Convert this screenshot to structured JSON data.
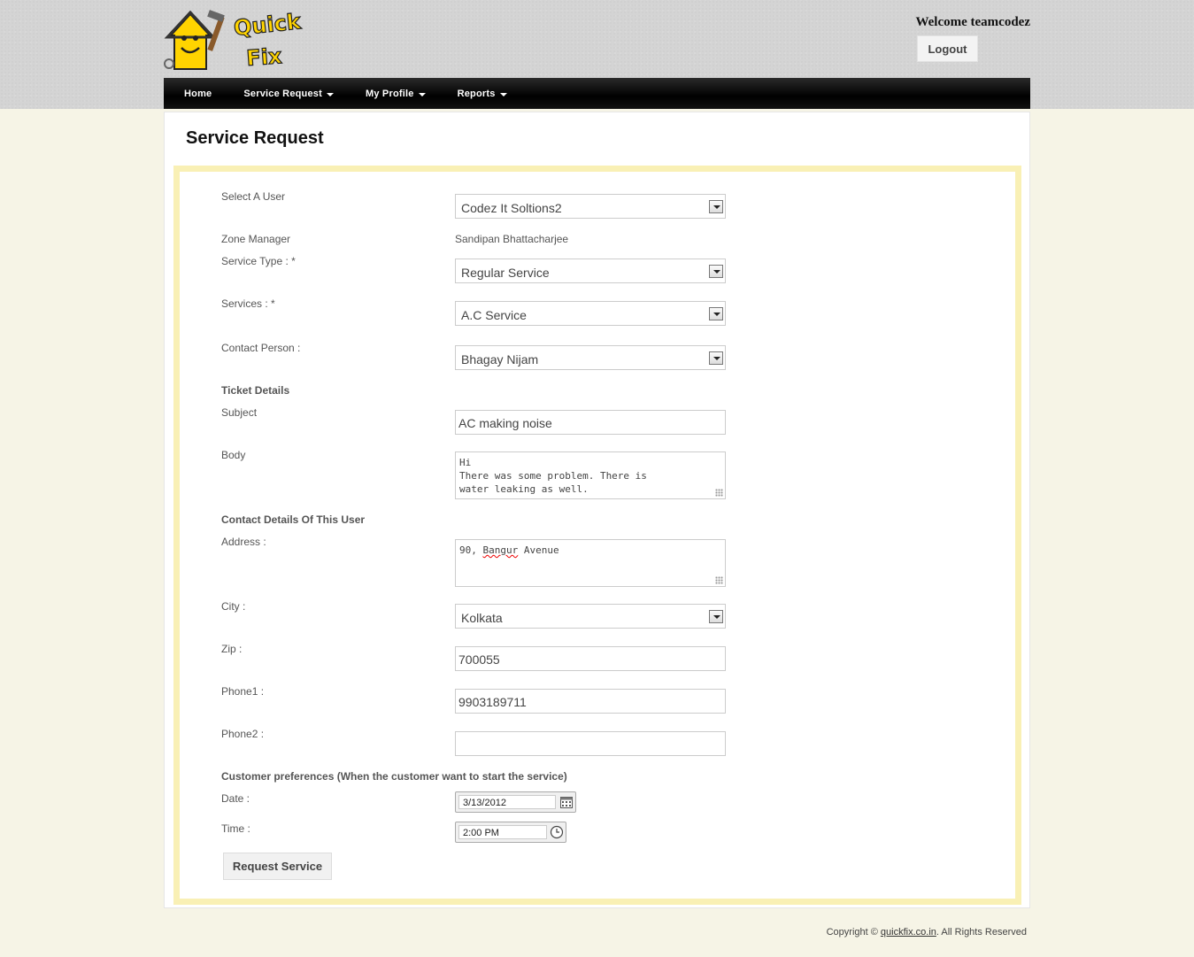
{
  "header": {
    "logo_text_line1": "Quick",
    "logo_text_line2": "Fix",
    "welcome": "Welcome teamcodez",
    "logout_label": "Logout"
  },
  "nav": {
    "home": "Home",
    "service_request": "Service Request",
    "my_profile": "My Profile",
    "reports": "Reports"
  },
  "page": {
    "title": "Service Request"
  },
  "form": {
    "select_user_label": "Select A User",
    "select_user_value": "Codez It Soltions2",
    "zone_manager_label": "Zone Manager",
    "zone_manager_value": "Sandipan Bhattacharjee",
    "service_type_label": "Service Type : *",
    "service_type_value": "Regular Service",
    "services_label": "Services : *",
    "services_value": "A.C Service",
    "contact_person_label": "Contact Person :",
    "contact_person_value": "Bhagay Nijam",
    "ticket_details_heading": "Ticket Details",
    "subject_label": "Subject",
    "subject_value": "AC making noise",
    "body_label": "Body",
    "body_value": "Hi\nThere was some problem. There is\nwater leaking as well.",
    "contact_details_heading": "Contact Details Of This User",
    "address_label": "Address :",
    "address_value_part1": "90, ",
    "address_value_part2": "Bangur",
    "address_value_part3": " Avenue",
    "city_label": "City :",
    "city_value": "Kolkata",
    "zip_label": "Zip :",
    "zip_value": "700055",
    "phone1_label": "Phone1 :",
    "phone1_value": "9903189711",
    "phone2_label": "Phone2 :",
    "phone2_value": "",
    "preferences_heading": "Customer preferences (When the customer want to start the service)",
    "date_label": "Date :",
    "date_value": "3/13/2012",
    "time_label": "Time :",
    "time_value": "2:00 PM",
    "submit_label": "Request Service"
  },
  "footer": {
    "copyright_prefix": "Copyright © ",
    "link_text": "quickfix.co.in",
    "copyright_suffix": ". All Rights Reserved"
  },
  "colors": {
    "frame_border": "#f9f0b5",
    "navbar": "#000000",
    "page_bg": "#f6f4e6",
    "logo_yellow": "#ffd400"
  },
  "icons": {
    "select_arrow": "chevron-down-icon",
    "date_picker": "calendar-icon",
    "time_picker": "clock-icon",
    "textarea_resize": "resize-grip-icon"
  }
}
